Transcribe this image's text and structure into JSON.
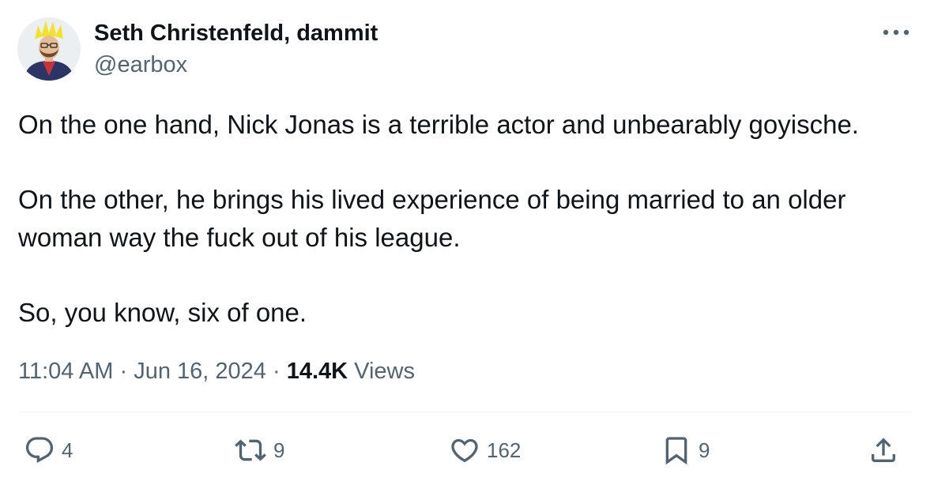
{
  "author": {
    "name": "Seth Christenfeld, dammit",
    "handle": "@earbox"
  },
  "tweet": {
    "paragraphs": [
      "On the one hand, Nick Jonas is a terrible actor and unbearably goyische.",
      "On the other, he brings his lived experience of being married to an older woman way the fuck out of his league.",
      "So, you know, six of one."
    ]
  },
  "meta": {
    "time": "11:04 AM",
    "separator": "·",
    "date": "Jun 16, 2024",
    "views_count": "14.4K",
    "views_label": "Views"
  },
  "actions": {
    "replies": "4",
    "retweets": "9",
    "likes": "162",
    "bookmarks": "9"
  },
  "colors": {
    "text_primary": "#0f1419",
    "text_secondary": "#536471",
    "divider": "#eff3f4"
  },
  "icons": {
    "avatar": "user-avatar",
    "more": "more-horizontal-icon",
    "reply": "reply-icon",
    "retweet": "retweet-icon",
    "like": "heart-icon",
    "bookmark": "bookmark-icon",
    "share": "share-icon"
  }
}
